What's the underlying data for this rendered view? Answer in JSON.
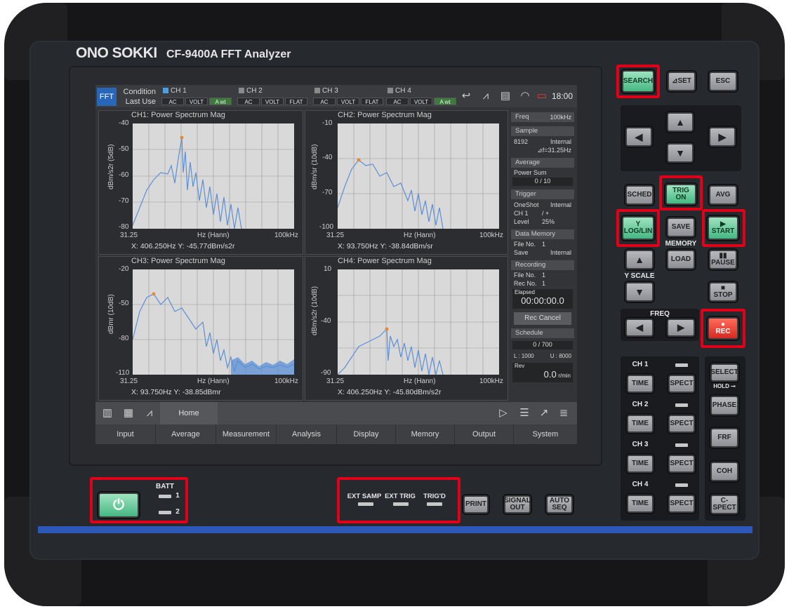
{
  "brand": "ONO SOKKI",
  "model": "CF-9400A  FFT Analyzer",
  "screen": {
    "mode": "FFT",
    "condition": "Condition",
    "last_use": "Last Use",
    "channels": [
      {
        "name": "CH 1",
        "tags": [
          "AC",
          "VOLT",
          "A wt"
        ]
      },
      {
        "name": "CH 2",
        "tags": [
          "AC",
          "VOLT",
          "FLAT"
        ]
      },
      {
        "name": "CH 3",
        "tags": [
          "AC",
          "VOLT",
          "FLAT"
        ]
      },
      {
        "name": "CH 4",
        "tags": [
          "AC",
          "VOLT",
          "A wt"
        ]
      }
    ],
    "clock": "18:00",
    "plots": [
      {
        "title": "CH1: Power Spectrum Mag",
        "ylabel": "dBm/s2r (5dB)",
        "yticks": [
          "-40",
          "-50",
          "-60",
          "-70",
          "-80"
        ],
        "xmin": "31.25",
        "xmid": "Hz (Hann)",
        "xmax": "100kHz",
        "cursor": "X: 406.250Hz Y: -45.77dBm/s2r"
      },
      {
        "title": "CH2: Power Spectrum Mag",
        "ylabel": "dBm/sr (10dB)",
        "yticks": [
          "-10",
          "-40",
          "-70",
          "-100"
        ],
        "xmin": "31.25",
        "xmid": "Hz (Hann)",
        "xmax": "100kHz",
        "cursor": "X: 93.750Hz Y: -38.84dBm/sr"
      },
      {
        "title": "CH3: Power Spectrum Mag",
        "ylabel": "dBmr (10dB)",
        "yticks": [
          "-20",
          "-50",
          "-80",
          "-110"
        ],
        "xmin": "31.25",
        "xmid": "Hz (Hann)",
        "xmax": "100kHz",
        "cursor": "X: 93.750Hz Y: -38.85dBmr"
      },
      {
        "title": "CH4: Power Spectrum Mag",
        "ylabel": "dBm/s2r (10dB)",
        "yticks": [
          "10",
          "-40",
          "-90"
        ],
        "xmin": "31.25",
        "xmid": "Hz (Hann)",
        "xmax": "100kHz",
        "cursor": "X: 406.250Hz Y: -45.80dBm/s2r"
      }
    ],
    "side": {
      "freq_label": "Freq",
      "freq_value": "100kHz",
      "sample_label": "Sample",
      "sample_n": "8192",
      "sample_src": "Internal",
      "sample_df": "⊿f=31.25Hz",
      "average_label": "Average",
      "average_mode": "Power Sum",
      "average_count": "0 / 10",
      "trigger_label": "Trigger",
      "trig_mode": "OneShot",
      "trig_src": "Internal",
      "trig_ch": "CH 1",
      "trig_slope": "/  +",
      "trig_level_l": "Level",
      "trig_level": "25%",
      "dm_label": "Data Memory",
      "dm_file_l": "File No.",
      "dm_file": "1",
      "dm_save_l": "Save",
      "dm_save": "Internal",
      "rec_label": "Recording",
      "rec_file_l": "File No.",
      "rec_file": "1",
      "rec_no_l": "Rec No.",
      "rec_no": "1",
      "elapsed_label": "Elapsed",
      "elapsed": "00:00:00.0",
      "rec_cancel": "Rec Cancel",
      "schedule_label": "Schedule",
      "schedule_count": "0 / 700",
      "sched_l": "L : 1000",
      "sched_u": "U : 8000",
      "rev_label": "Rev",
      "rev_value": "0.0",
      "rev_unit": "r/min"
    },
    "home": "Home",
    "menu": [
      "Input",
      "Average",
      "Measurement",
      "Analysis",
      "Display",
      "Memory",
      "Output",
      "System"
    ]
  },
  "keys": {
    "search": "SEARCH",
    "set": "⊿SET",
    "esc": "ESC",
    "sched": "SCHED",
    "trig_on": "TRIG ON",
    "avg": "AVG",
    "log_lin": "LOG/LIN",
    "save": "SAVE",
    "start": "START",
    "memory": "MEMORY",
    "load": "LOAD",
    "pause": "PAUSE",
    "y_scale": "Y SCALE",
    "stop": "STOP",
    "freq": "FREQ",
    "rec": "REC",
    "ch_labels": [
      "CH 1",
      "CH 2",
      "CH 3",
      "CH 4"
    ],
    "time": "TIME",
    "spect": "SPECT",
    "select": "SELECT",
    "hold": "HOLD",
    "phase": "PHASE",
    "frf": "FRF",
    "coh": "COH",
    "cspect": "C-SPECT",
    "batt": "BATT",
    "batt1": "1",
    "batt2": "2",
    "ext_samp": "EXT SAMP",
    "ext_trig": "EXT TRIG",
    "trigd": "TRIG'D",
    "print": "PRINT",
    "signal": "SIGNAL",
    "out": "OUT",
    "auto": "AUTO",
    "seq": "SEQ"
  }
}
